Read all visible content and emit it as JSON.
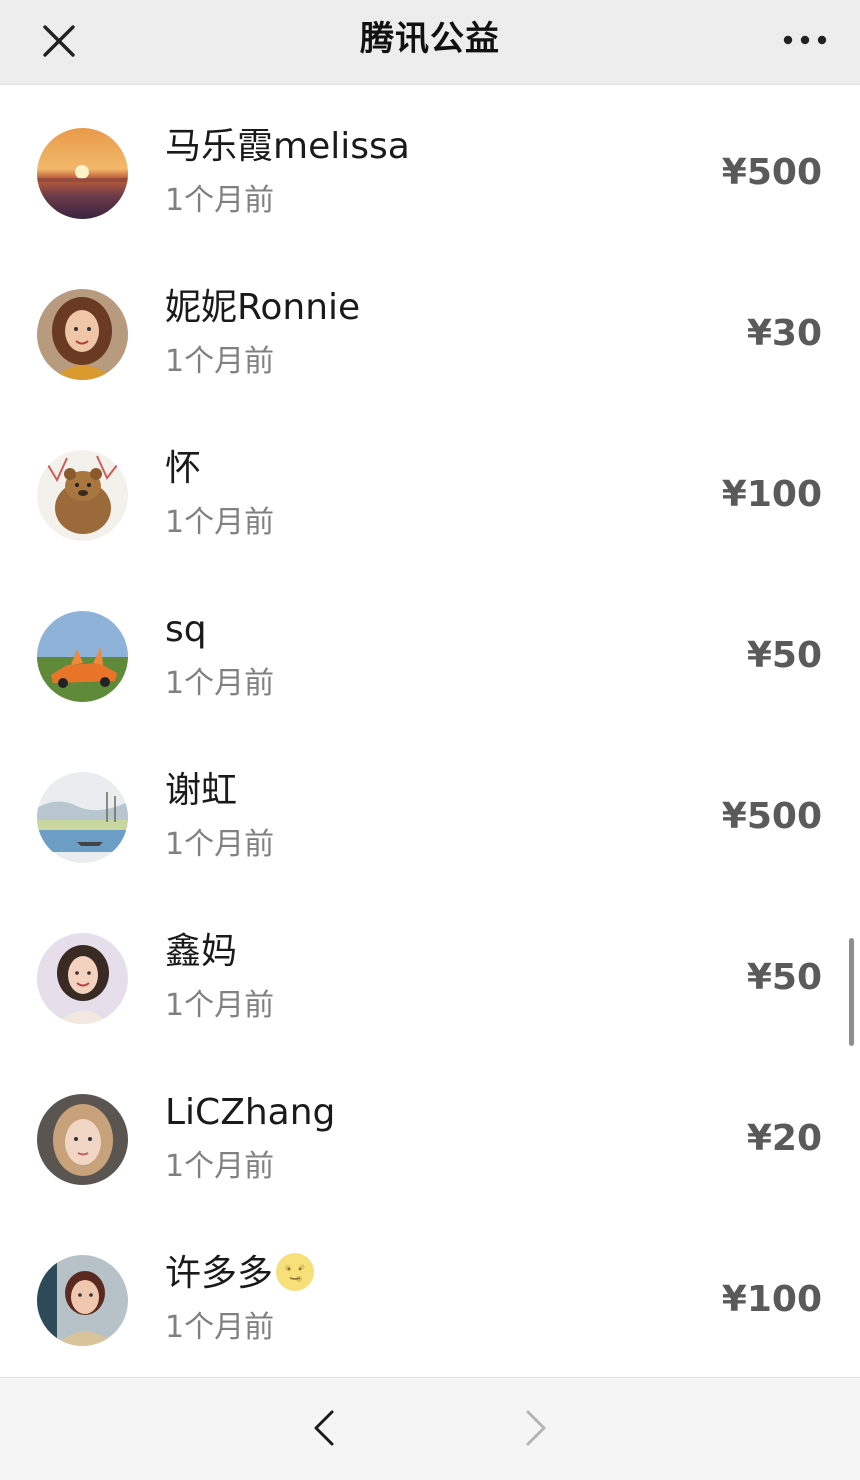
{
  "header": {
    "title": "腾讯公益",
    "close_icon": "close-icon",
    "more_icon": "more-dots-icon"
  },
  "donations": [
    {
      "name": "马乐霞melissa",
      "time": "1个月前",
      "amount": "¥500",
      "avatar": "sunset-avatar"
    },
    {
      "name": "妮妮Ronnie",
      "time": "1个月前",
      "amount": "¥30",
      "avatar": "woman-portrait-avatar"
    },
    {
      "name": "怀",
      "time": "1个月前",
      "amount": "¥100",
      "avatar": "bear-drawing-avatar"
    },
    {
      "name": "sq",
      "time": "1个月前",
      "amount": "¥50",
      "avatar": "sports-car-avatar"
    },
    {
      "name": "谢虹",
      "time": "1个月前",
      "amount": "¥500",
      "avatar": "landscape-painting-avatar"
    },
    {
      "name": "鑫妈",
      "time": "1个月前",
      "amount": "¥50",
      "avatar": "woman-portrait-avatar"
    },
    {
      "name": "LiCZhang",
      "time": "1个月前",
      "amount": "¥20",
      "avatar": "woman-selfie-avatar"
    },
    {
      "name": "许多多",
      "time": "1个月前",
      "amount": "¥100",
      "avatar": "woman-photo-avatar",
      "name_emoji": "moon-face-emoji"
    }
  ],
  "footer": {
    "back_icon": "chevron-left-icon",
    "forward_icon": "chevron-right-icon"
  },
  "colors": {
    "topbar_bg": "#ededed",
    "bottombar_bg": "#f5f5f5",
    "amount_text": "#5a5a5a",
    "time_text": "#808080"
  }
}
